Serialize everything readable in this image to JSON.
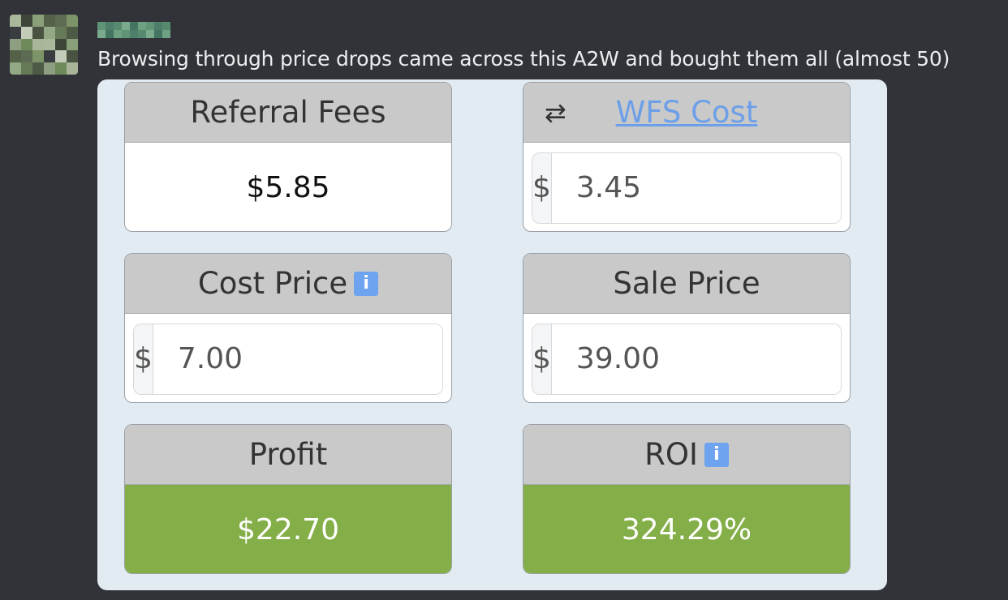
{
  "message": {
    "text": "Browsing through price drops came across this A2W and bought them all (almost 50)"
  },
  "calculator": {
    "referral_fees": {
      "label": "Referral Fees",
      "value": "$5.85"
    },
    "wfs_cost": {
      "label": "WFS Cost",
      "prefix": "$",
      "value": "3.45",
      "icon": "swap-arrows-icon"
    },
    "cost_price": {
      "label": "Cost Price",
      "prefix": "$",
      "value": "7.00",
      "info_icon": "i"
    },
    "sale_price": {
      "label": "Sale Price",
      "prefix": "$",
      "value": "39.00"
    },
    "profit": {
      "label": "Profit",
      "value": "$22.70"
    },
    "roi": {
      "label": "ROI",
      "value": "324.29%",
      "info_icon": "i"
    }
  },
  "colors": {
    "background": "#313338",
    "embed_background": "#e3ebf2",
    "header_gray": "#c9c9c9",
    "result_green": "#84ae47",
    "info_blue": "#6ea3f0",
    "link_blue": "#6d9fe8"
  }
}
